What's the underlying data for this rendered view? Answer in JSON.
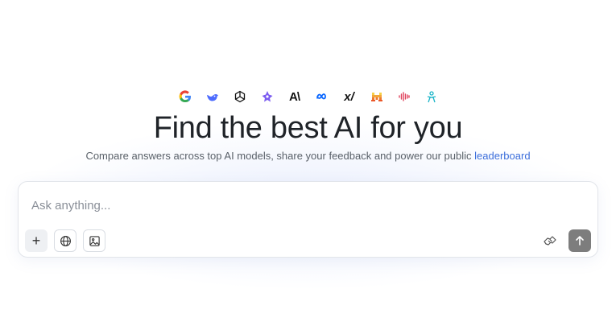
{
  "hero": {
    "logos": [
      {
        "name": "google-icon",
        "color": "#4285F4"
      },
      {
        "name": "deepseek-icon",
        "color": "#4d6bfe"
      },
      {
        "name": "openai-icon",
        "color": "#111111"
      },
      {
        "name": "gemini-spark-icon",
        "color": "#7b5cf0"
      },
      {
        "name": "anthropic-icon",
        "glyph": "A\\",
        "color": "#111111"
      },
      {
        "name": "meta-icon",
        "color": "#0866ff"
      },
      {
        "name": "xai-icon",
        "glyph": "x/",
        "color": "#111111"
      },
      {
        "name": "mistral-icon",
        "color": "#f7a21a"
      },
      {
        "name": "audio-wave-icon",
        "color": "#e0445e"
      },
      {
        "name": "nvidia-icon",
        "color": "#19b4c8"
      }
    ],
    "title": "Find the best AI for you",
    "subtitle_prefix": "Compare answers across top AI models, share your feedback and power our public",
    "subtitle_link": "leaderboard"
  },
  "chat": {
    "placeholder": "Ask anything...",
    "add_label": "+"
  }
}
